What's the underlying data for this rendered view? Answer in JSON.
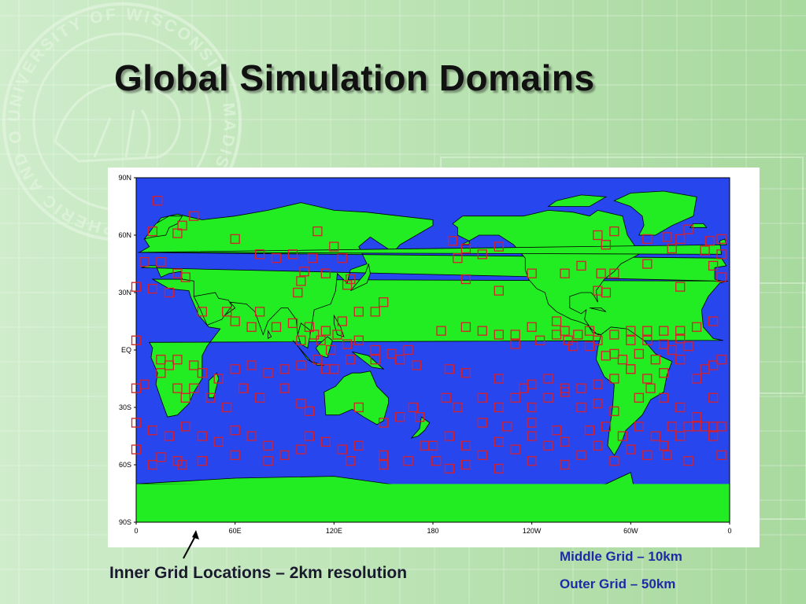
{
  "slide": {
    "title": "Global Simulation Domains",
    "seal_text": "UNIVERSITY OF WISCONSIN - MADISON · ATMOSPHERIC AND OCEANIC SCIENCES"
  },
  "map": {
    "y_axis_labels": [
      "90N",
      "60N",
      "30N",
      "EQ",
      "30S",
      "60S",
      "90S"
    ],
    "x_axis_labels": [
      "0",
      "60E",
      "120E",
      "180",
      "120W",
      "60W",
      "0"
    ],
    "colors": {
      "ocean": "#2846ee",
      "land": "#22ec22",
      "marker": "#d6202b"
    },
    "grid_locations": [
      [
        13,
        78
      ],
      [
        35,
        70
      ],
      [
        28,
        65
      ],
      [
        -25,
        63
      ],
      [
        -30,
        58
      ],
      [
        60,
        58
      ],
      [
        25,
        61
      ],
      [
        10,
        62
      ],
      [
        -5,
        58
      ],
      [
        -70,
        62
      ],
      [
        -80,
        60
      ],
      [
        -75,
        55
      ],
      [
        -50,
        58
      ],
      [
        -38,
        59
      ],
      [
        -35,
        53
      ],
      [
        -12,
        57
      ],
      [
        120,
        54
      ],
      [
        110,
        62
      ],
      [
        -168,
        57
      ],
      [
        -160,
        53
      ],
      [
        -150,
        50
      ],
      [
        -140,
        54
      ],
      [
        -165,
        48
      ],
      [
        75,
        50
      ],
      [
        85,
        48
      ],
      [
        95,
        50
      ],
      [
        107,
        48
      ],
      [
        125,
        48
      ],
      [
        115,
        40
      ],
      [
        102,
        41
      ],
      [
        100,
        36
      ],
      [
        98,
        30
      ],
      [
        130,
        37
      ],
      [
        128,
        34
      ],
      [
        -160,
        37
      ],
      [
        -140,
        31
      ],
      [
        -120,
        40
      ],
      [
        -100,
        40
      ],
      [
        -90,
        44
      ],
      [
        -78,
        40
      ],
      [
        -70,
        40
      ],
      [
        -80,
        31
      ],
      [
        -75,
        30
      ],
      [
        -10,
        44
      ],
      [
        -5,
        38
      ],
      [
        -15,
        52
      ],
      [
        -5,
        50
      ],
      [
        5,
        46
      ],
      [
        15,
        46
      ],
      [
        25,
        40
      ],
      [
        30,
        38
      ],
      [
        -30,
        33
      ],
      [
        0,
        33
      ],
      [
        10,
        32
      ],
      [
        20,
        30
      ],
      [
        -50,
        45
      ],
      [
        40,
        20
      ],
      [
        55,
        20
      ],
      [
        60,
        15
      ],
      [
        75,
        20
      ],
      [
        70,
        12
      ],
      [
        85,
        12
      ],
      [
        95,
        14
      ],
      [
        105,
        12
      ],
      [
        115,
        10
      ],
      [
        125,
        15
      ],
      [
        135,
        20
      ],
      [
        145,
        20
      ],
      [
        150,
        25
      ],
      [
        100,
        5
      ],
      [
        108,
        8
      ],
      [
        112,
        5
      ],
      [
        118,
        0
      ],
      [
        122,
        8
      ],
      [
        128,
        3
      ],
      [
        135,
        5
      ],
      [
        145,
        0
      ],
      [
        155,
        -2
      ],
      [
        165,
        0
      ],
      [
        -150,
        10
      ],
      [
        -140,
        8
      ],
      [
        -130,
        3
      ],
      [
        -115,
        5
      ],
      [
        -105,
        8
      ],
      [
        -98,
        5
      ],
      [
        -92,
        8
      ],
      [
        -85,
        10
      ],
      [
        -70,
        8
      ],
      [
        -60,
        5
      ],
      [
        -50,
        5
      ],
      [
        -40,
        3
      ],
      [
        -30,
        6
      ],
      [
        -10,
        -8
      ],
      [
        -175,
        10
      ],
      [
        -160,
        12
      ],
      [
        -130,
        8
      ],
      [
        -120,
        12
      ],
      [
        -105,
        15
      ],
      [
        -100,
        10
      ],
      [
        -75,
        -3
      ],
      [
        -70,
        -2
      ],
      [
        -65,
        -5
      ],
      [
        -60,
        -10
      ],
      [
        -55,
        -2
      ],
      [
        -45,
        -5
      ],
      [
        -35,
        0
      ],
      [
        -25,
        2
      ],
      [
        -95,
        2
      ],
      [
        -85,
        2
      ],
      [
        -80,
        5
      ],
      [
        -60,
        10
      ],
      [
        -50,
        10
      ],
      [
        -40,
        10
      ],
      [
        -30,
        10
      ],
      [
        -20,
        12
      ],
      [
        -10,
        15
      ],
      [
        0,
        5
      ],
      [
        15,
        -5
      ],
      [
        20,
        -8
      ],
      [
        25,
        -5
      ],
      [
        35,
        -8
      ],
      [
        40,
        -12
      ],
      [
        50,
        -15
      ],
      [
        60,
        -10
      ],
      [
        70,
        -8
      ],
      [
        80,
        -12
      ],
      [
        90,
        -10
      ],
      [
        100,
        -8
      ],
      [
        110,
        -5
      ],
      [
        115,
        -10
      ],
      [
        120,
        -10
      ],
      [
        130,
        -5
      ],
      [
        145,
        -5
      ],
      [
        160,
        -5
      ],
      [
        170,
        -8
      ],
      [
        -170,
        -10
      ],
      [
        -160,
        -12
      ],
      [
        -140,
        -15
      ],
      [
        -125,
        -20
      ],
      [
        -120,
        -18
      ],
      [
        -110,
        -15
      ],
      [
        -100,
        -20
      ],
      [
        -90,
        -20
      ],
      [
        -80,
        -18
      ],
      [
        -70,
        -15
      ],
      [
        -60,
        -10
      ],
      [
        -50,
        -15
      ],
      [
        -40,
        -12
      ],
      [
        -30,
        -5
      ],
      [
        -20,
        -15
      ],
      [
        -15,
        -10
      ],
      [
        -5,
        -5
      ],
      [
        -10,
        -25
      ],
      [
        0,
        -20
      ],
      [
        5,
        -18
      ],
      [
        15,
        -12
      ],
      [
        25,
        -20
      ],
      [
        30,
        -25
      ],
      [
        35,
        -20
      ],
      [
        45,
        -25
      ],
      [
        55,
        -30
      ],
      [
        65,
        -20
      ],
      [
        75,
        -25
      ],
      [
        90,
        -20
      ],
      [
        100,
        -28
      ],
      [
        105,
        -32
      ],
      [
        135,
        -30
      ],
      [
        150,
        -38
      ],
      [
        160,
        -35
      ],
      [
        168,
        -30
      ],
      [
        172,
        -35
      ],
      [
        -172,
        -25
      ],
      [
        -165,
        -30
      ],
      [
        -150,
        -25
      ],
      [
        -140,
        -30
      ],
      [
        -130,
        -25
      ],
      [
        -120,
        -30
      ],
      [
        -110,
        -25
      ],
      [
        -100,
        -22
      ],
      [
        -90,
        -30
      ],
      [
        -80,
        -28
      ],
      [
        -70,
        -32
      ],
      [
        -55,
        -25
      ],
      [
        -48,
        -20
      ],
      [
        -40,
        -25
      ],
      [
        -30,
        -30
      ],
      [
        -20,
        -35
      ],
      [
        -10,
        -40
      ],
      [
        0,
        -38
      ],
      [
        10,
        -42
      ],
      [
        20,
        -45
      ],
      [
        30,
        -40
      ],
      [
        40,
        -45
      ],
      [
        50,
        -48
      ],
      [
        60,
        -42
      ],
      [
        70,
        -45
      ],
      [
        80,
        -50
      ],
      [
        90,
        -55
      ],
      [
        105,
        -45
      ],
      [
        115,
        -48
      ],
      [
        125,
        -52
      ],
      [
        135,
        -50
      ],
      [
        150,
        -55
      ],
      [
        165,
        -58
      ],
      [
        175,
        -50
      ],
      [
        -170,
        -45
      ],
      [
        -160,
        -50
      ],
      [
        -150,
        -55
      ],
      [
        -140,
        -48
      ],
      [
        -130,
        -52
      ],
      [
        -120,
        -45
      ],
      [
        -110,
        -50
      ],
      [
        -100,
        -48
      ],
      [
        -90,
        -55
      ],
      [
        -80,
        -50
      ],
      [
        -70,
        -58
      ],
      [
        -60,
        -52
      ],
      [
        -50,
        -55
      ],
      [
        -40,
        -50
      ],
      [
        -30,
        -45
      ],
      [
        -20,
        -40
      ],
      [
        -10,
        -45
      ],
      [
        -5,
        -55
      ],
      [
        -150,
        -38
      ],
      [
        -135,
        -40
      ],
      [
        -120,
        -38
      ],
      [
        -105,
        -42
      ],
      [
        -85,
        -42
      ],
      [
        -75,
        -40
      ],
      [
        -65,
        -45
      ],
      [
        -55,
        -40
      ],
      [
        -45,
        -45
      ],
      [
        -35,
        -40
      ],
      [
        -25,
        -40
      ],
      [
        -15,
        -40
      ],
      [
        -5,
        -40
      ],
      [
        -38,
        -55
      ],
      [
        -25,
        -58
      ],
      [
        10,
        -60
      ],
      [
        25,
        -58
      ],
      [
        40,
        -58
      ],
      [
        60,
        -55
      ],
      [
        80,
        -58
      ],
      [
        100,
        -52
      ],
      [
        130,
        -58
      ],
      [
        150,
        -60
      ],
      [
        -100,
        -60
      ],
      [
        -120,
        -58
      ],
      [
        -140,
        -62
      ],
      [
        -160,
        -60
      ],
      [
        -180,
        -50
      ],
      [
        0,
        -52
      ],
      [
        15,
        -56
      ],
      [
        28,
        -60
      ],
      [
        -178,
        -58
      ],
      [
        -170,
        -62
      ]
    ]
  },
  "captions": {
    "inner": "Inner Grid Locations – 2km resolution",
    "middle": "Middle Grid – 10km",
    "outer": "Outer Grid –  50km"
  }
}
